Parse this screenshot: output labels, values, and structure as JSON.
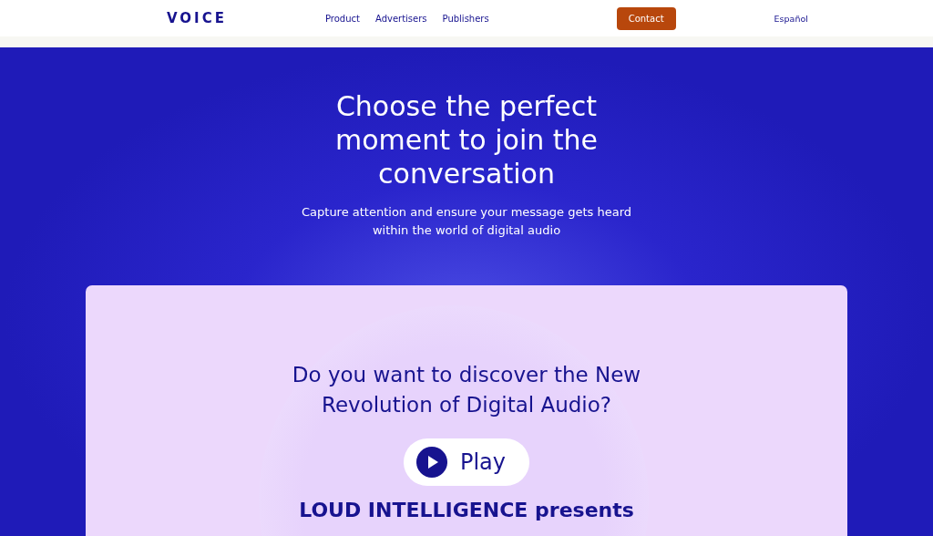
{
  "header": {
    "logo": "VOICE",
    "nav": [
      {
        "label": "Product"
      },
      {
        "label": "Advertisers"
      },
      {
        "label": "Publishers"
      }
    ],
    "contact_button": "Contact",
    "language": "Español"
  },
  "hero": {
    "title": "Choose the perfect moment to join the conversation",
    "subtitle": "Capture attention and ensure your message gets heard within the world of digital audio"
  },
  "card": {
    "question": "Do you want to discover the New Revolution of Digital Audio?",
    "play_button": "Play",
    "footer_text": "LOUD INTELLIGENCE presents"
  }
}
